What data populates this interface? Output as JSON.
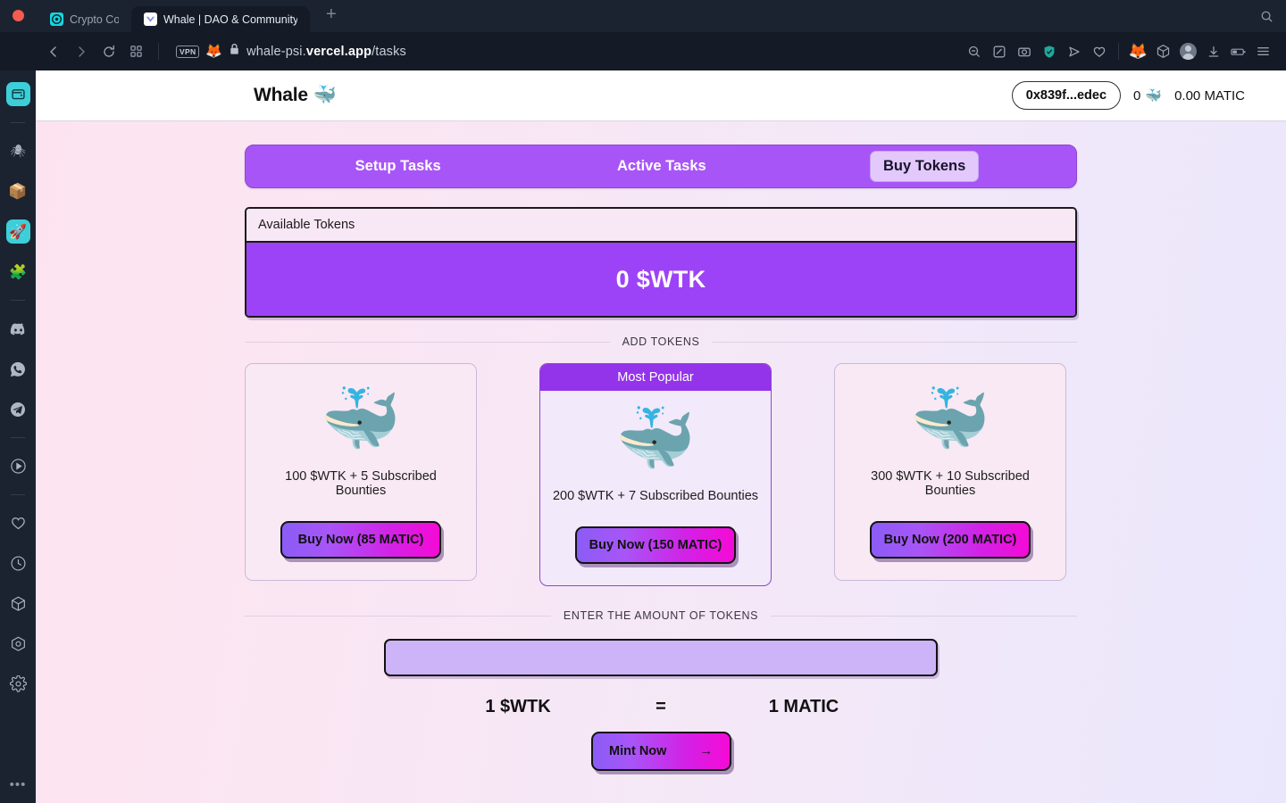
{
  "browser": {
    "tabs": [
      {
        "title": "Crypto Corne",
        "favicon": "crypto-corner-icon",
        "active": false
      },
      {
        "title": "Whale | DAO & Community",
        "favicon": "whale-site-icon",
        "active": true
      }
    ],
    "new_tab_label": "+",
    "window_search_icon": "search-icon",
    "toolbar": {
      "back_icon": "back-arrow-icon",
      "forward_icon": "forward-arrow-icon",
      "reload_icon": "reload-icon",
      "tabs_overview_icon": "grid-icon",
      "vpn_badge": "VPN",
      "extension_icon": "metamask-fox-icon",
      "lock_icon": "padlock-icon",
      "url_prefix": "whale-psi.",
      "url_domain": "vercel.app",
      "url_path": "/tasks",
      "right_icons": [
        "zoom-out-icon",
        "annotate-icon",
        "screenshot-icon",
        "shield-check-icon",
        "send-icon",
        "heart-icon",
        "metamask-fox-icon",
        "package-icon",
        "profile-avatar-icon",
        "download-icon",
        "battery-icon",
        "menu-icon"
      ]
    }
  },
  "sidebar": {
    "items": [
      {
        "name": "wallet",
        "glyph": "👛",
        "selected": true
      },
      {
        "name": "divider",
        "glyph": "",
        "selected": false
      },
      {
        "name": "spider",
        "glyph": "🕷",
        "selected": false
      },
      {
        "name": "package",
        "glyph": "📦",
        "selected": false
      },
      {
        "name": "rocket",
        "glyph": "🚀",
        "selected": true
      },
      {
        "name": "puzzle",
        "glyph": "🧩",
        "selected": false
      },
      {
        "name": "divider",
        "glyph": "",
        "selected": false
      },
      {
        "name": "discord",
        "glyph": "●●",
        "selected": false
      },
      {
        "name": "whatsapp",
        "glyph": "✆",
        "selected": false
      },
      {
        "name": "telegram",
        "glyph": "➤",
        "selected": false
      },
      {
        "name": "divider",
        "glyph": "",
        "selected": false
      },
      {
        "name": "play",
        "glyph": "▶",
        "selected": false
      },
      {
        "name": "divider",
        "glyph": "",
        "selected": false
      },
      {
        "name": "favorites",
        "glyph": "♡",
        "selected": false
      },
      {
        "name": "history",
        "glyph": "◴",
        "selected": false
      },
      {
        "name": "box",
        "glyph": "⬟",
        "selected": false
      },
      {
        "name": "target",
        "glyph": "◎",
        "selected": false
      },
      {
        "name": "settings",
        "glyph": "⚙",
        "selected": false
      }
    ],
    "more_label": "•••"
  },
  "header": {
    "brand": "Whale",
    "brand_emoji": "🐳",
    "wallet_address": "0x839f...edec",
    "token_balance": "0",
    "token_emoji": "🐳",
    "native_balance": "0.00 MATIC"
  },
  "tabs": {
    "items": [
      {
        "label": "Setup Tasks",
        "active": false
      },
      {
        "label": "Active Tasks",
        "active": false
      },
      {
        "label": "Buy Tokens",
        "active": true
      }
    ]
  },
  "available": {
    "header_label": "Available Tokens",
    "value": "0 $WTK"
  },
  "add_tokens_label": "ADD TOKENS",
  "packages": [
    {
      "badge": "",
      "emoji": "🐳",
      "description": "100 $WTK + 5 Subscribed Bounties",
      "buy_label": "Buy Now (85 MATIC)",
      "tokens": 100,
      "bounties": 5,
      "price_matic": 85,
      "featured": false
    },
    {
      "badge": "Most Popular",
      "emoji": "🐳",
      "description": "200 $WTK + 7 Subscribed Bounties",
      "buy_label": "Buy Now (150 MATIC)",
      "tokens": 200,
      "bounties": 7,
      "price_matic": 150,
      "featured": true
    },
    {
      "badge": "",
      "emoji": "🐳",
      "description": "300 $WTK + 10 Subscribed Bounties",
      "buy_label": "Buy Now (200 MATIC)",
      "tokens": 300,
      "bounties": 10,
      "price_matic": 200,
      "featured": false
    }
  ],
  "mint": {
    "section_label": "ENTER THE AMOUNT OF TOKENS",
    "input_value": "",
    "input_placeholder": "",
    "rate_left": "1 $WTK",
    "rate_equals": "=",
    "rate_right": "1 MATIC",
    "button_label": "Mint Now",
    "button_arrow": "→"
  },
  "colors": {
    "accent_purple": "#a855f7",
    "deep_purple": "#9d43f7",
    "magenta": "#f50ad6",
    "chrome_dark": "#141b26",
    "sidebar_dark": "#1b2330",
    "teal_selected": "#3ccfd9"
  }
}
